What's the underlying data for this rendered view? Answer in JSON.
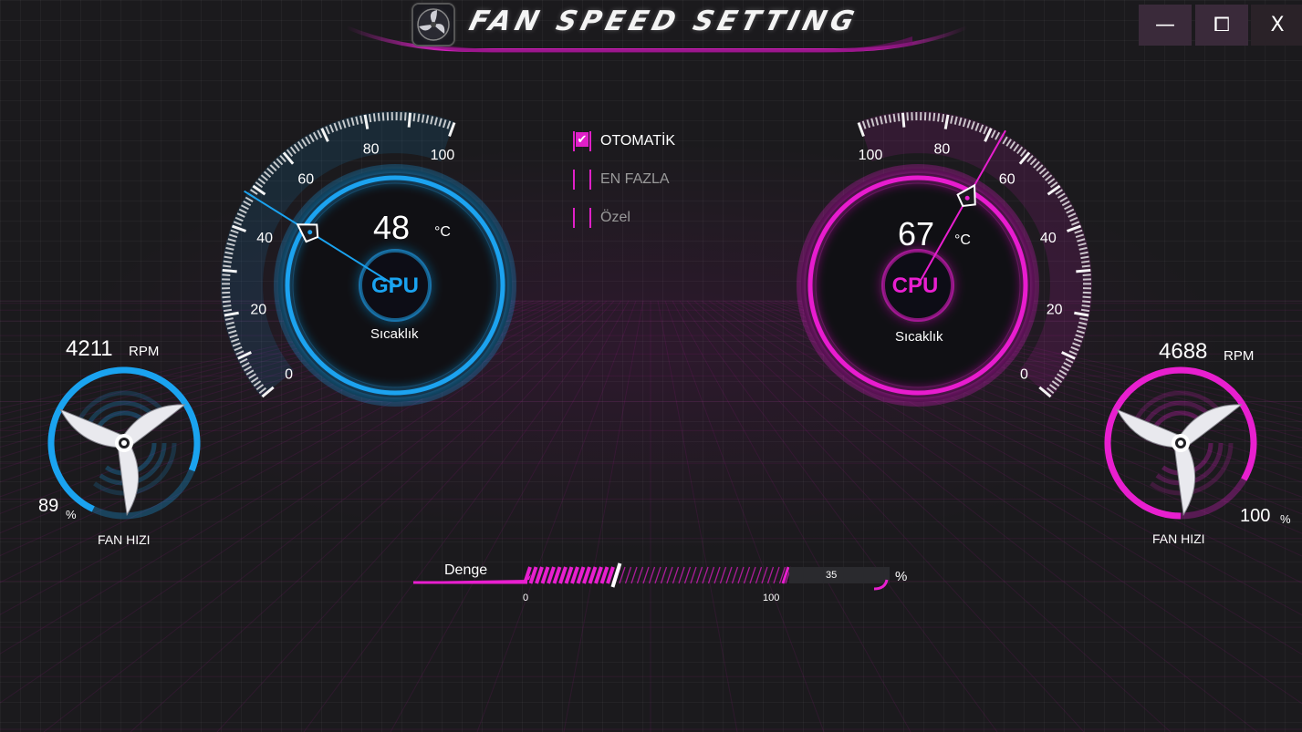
{
  "window": {
    "title": "FAN SPEED SETTING",
    "controls": {
      "minimize": "—",
      "maximize": "⧠",
      "close": "X"
    }
  },
  "colors": {
    "gpu_accent": "#1aa3f0",
    "cpu_accent": "#e81fcf",
    "background": "#1b1a1d"
  },
  "gpu": {
    "chip_label": "GPU",
    "temperature": "48",
    "temperature_value": 48,
    "unit": "°C",
    "caption": "Sıcaklık",
    "scale_labels": [
      "0",
      "20",
      "40",
      "60",
      "80",
      "100"
    ]
  },
  "cpu": {
    "chip_label": "CPU",
    "temperature": "67",
    "temperature_value": 67,
    "unit": "°C",
    "caption": "Sıcaklık",
    "scale_labels": [
      "0",
      "20",
      "40",
      "60",
      "80",
      "100"
    ]
  },
  "modes": [
    {
      "label": "OTOMATİK",
      "checked": true
    },
    {
      "label": "EN FAZLA",
      "checked": false
    },
    {
      "label": "Özel",
      "checked": false
    }
  ],
  "fans": {
    "left": {
      "rpm": "4211",
      "rpm_unit": "RPM",
      "percent": "89",
      "percent_unit": "%",
      "percent_value": 89,
      "label": "FAN HIZI"
    },
    "right": {
      "rpm": "4688",
      "rpm_unit": "RPM",
      "percent": "100",
      "percent_unit": "%",
      "percent_value": 100,
      "label": "FAN HIZI"
    }
  },
  "slider": {
    "label": "Denge",
    "min": "0",
    "max": "100",
    "value": "35",
    "value_number": 35,
    "unit": "%"
  }
}
